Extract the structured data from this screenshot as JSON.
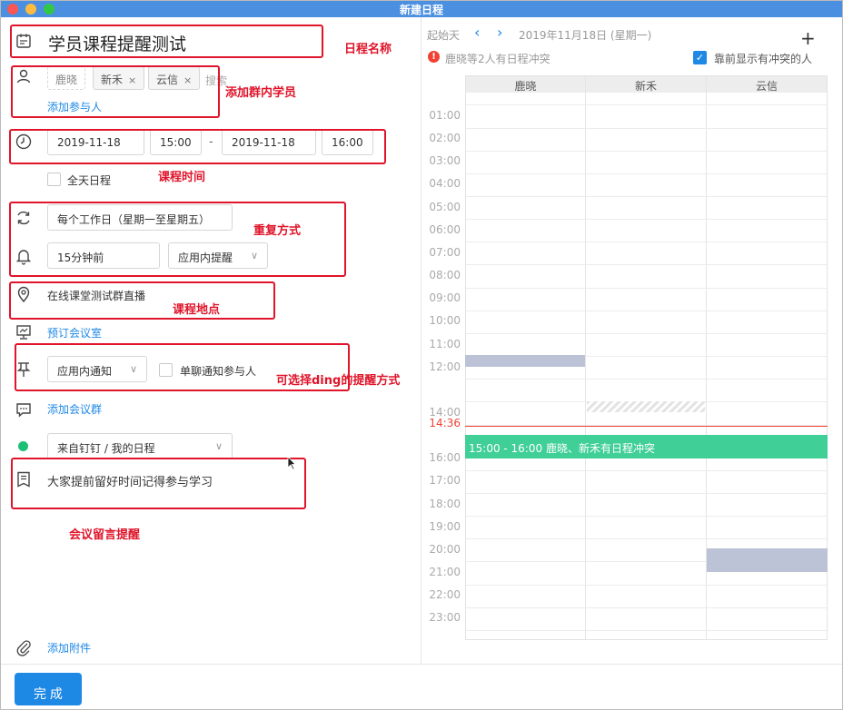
{
  "window": {
    "title": "新建日程"
  },
  "form": {
    "title": "学员课程提醒测试",
    "participants": [
      {
        "name": "鹿晓",
        "removable": false
      },
      {
        "name": "新禾",
        "removable": true
      },
      {
        "name": "云信",
        "removable": true
      }
    ],
    "remove_glyph": "×",
    "search_placeholder": "搜索",
    "add_participant": "添加参与人",
    "start_date": "2019-11-18",
    "start_time": "15:00",
    "range_separator": "-",
    "end_date": "2019-11-18",
    "end_time": "16:00",
    "all_day": "全天日程",
    "repeat": "每个工作日（星期一至星期五）",
    "reminder_time": "15分钟前",
    "reminder_type": "应用内提醒",
    "location": "在线课堂测试群直播",
    "book_room": "预订会议室",
    "notify_type": "应用内通知",
    "single_notify": "单聊通知参与人",
    "add_group": "添加会议群",
    "calendar_source": "来自钉钉 / 我的日程",
    "note": "大家提前留好时间记得参与学习",
    "add_attachment": "添加附件",
    "done": "完 成"
  },
  "annotations": {
    "schedule_name": "日程名称",
    "add_members": "添加群内学员",
    "course_time": "课程时间",
    "repeat_mode": "重复方式",
    "location": "课程地点",
    "ding_reminder": "可选择ding的提醒方式",
    "meeting_note": "会议留言提醒"
  },
  "calendar": {
    "start_day_label": "起始天",
    "date": "2019年11月18日 (星期一)",
    "conflict_warning": "鹿晓等2人有日程冲突",
    "show_conflict_first": "靠前显示有冲突的人",
    "columns": [
      "鹿晓",
      "新禾",
      "云信"
    ],
    "hours": [
      "01:00",
      "02:00",
      "03:00",
      "04:00",
      "05:00",
      "06:00",
      "07:00",
      "08:00",
      "09:00",
      "10:00",
      "11:00",
      "12:00",
      "14:00",
      "16:00",
      "17:00",
      "18:00",
      "19:00",
      "20:00",
      "21:00",
      "22:00",
      "23:00"
    ],
    "now_time": "14:36",
    "event_text": "15:00 - 16:00 鹿晓、新禾有日程冲突"
  },
  "colors": {
    "accent": "#1e88e5",
    "annotation": "#e0142a",
    "event": "#41cf98",
    "busy": "#bcc3d6",
    "now_line": "#f04134"
  }
}
